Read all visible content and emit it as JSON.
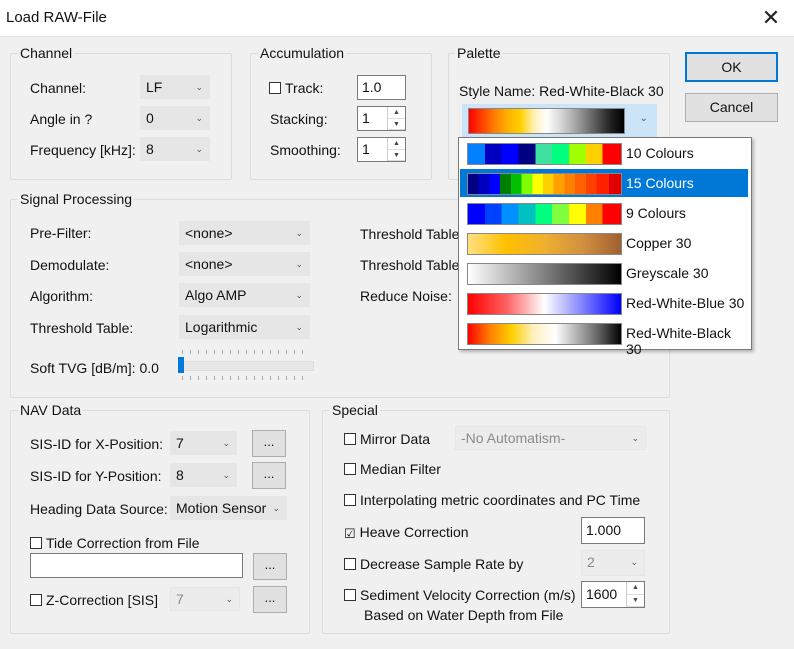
{
  "window": {
    "title": "Load RAW-File",
    "close_glyph": "✕"
  },
  "channel": {
    "title": "Channel",
    "channel_label": "Channel:",
    "channel_value": "LF",
    "angle_label": "Angle in ?",
    "angle_value": "0",
    "frequency_label": "Frequency [kHz]:",
    "frequency_value": "8"
  },
  "accumulation": {
    "title": "Accumulation",
    "track_label": "Track:",
    "track_value": "1.0",
    "stacking_label": "Stacking:",
    "stacking_value": "1",
    "smoothing_label": "Smoothing:",
    "smoothing_value": "1"
  },
  "palette": {
    "title": "Palette",
    "style_name": "Style Name: Red-White-Black 30",
    "options": [
      {
        "label": "10 Colours",
        "selected": false
      },
      {
        "label": "15 Colours",
        "selected": true
      },
      {
        "label": "9 Colours",
        "selected": false
      },
      {
        "label": "Copper 30",
        "selected": false
      },
      {
        "label": "Greyscale 30",
        "selected": false
      },
      {
        "label": "Red-White-Blue 30",
        "selected": false
      },
      {
        "label": "Red-White-Black 30",
        "selected": false
      }
    ]
  },
  "buttons": {
    "ok": "OK",
    "cancel": "Cancel",
    "browse": "..."
  },
  "signal": {
    "title": "Signal Processing",
    "prefilter_label": "Pre-Filter:",
    "prefilter_value": "<none>",
    "demodulate_label": "Demodulate:",
    "demodulate_value": "<none>",
    "algorithm_label": "Algorithm:",
    "algorithm_value": "Algo AMP",
    "threshold_label": "Threshold Table:",
    "threshold_value": "Logarithmic",
    "soft_tvg_label": "Soft TVG [dB/m]: 0.0",
    "threshold_table_a": "Threshold Table",
    "threshold_table_b": "Threshold Table",
    "reduce_noise": "Reduce Noise:",
    "soft_tvg_level": 0
  },
  "nav": {
    "title": "NAV Data",
    "sisx_label": "SIS-ID for X-Position:",
    "sisx_value": "7",
    "sisy_label": "SIS-ID for Y-Position:",
    "sisy_value": "8",
    "heading_label": "Heading Data Source:",
    "heading_value": "Motion Sensor",
    "tide_label": "Tide Correction from File",
    "tide_value": "",
    "z_label": "Z-Correction [SIS]",
    "z_value": "7"
  },
  "special": {
    "title": "Special",
    "mirror_label": "Mirror Data",
    "mirror_value": "-No Automatism-",
    "median_label": "Median Filter",
    "interp_label": "Interpolating metric coordinates and PC Time",
    "heave_label": "Heave Correction",
    "heave_value": "1.000",
    "decrease_label": "Decrease Sample Rate by",
    "decrease_value": "2",
    "sediment_label": "Sediment Velocity Correction (m/s)",
    "sediment_label2": "Based on Water Depth from File",
    "sediment_value": "1600",
    "heave_checked": "☑"
  }
}
